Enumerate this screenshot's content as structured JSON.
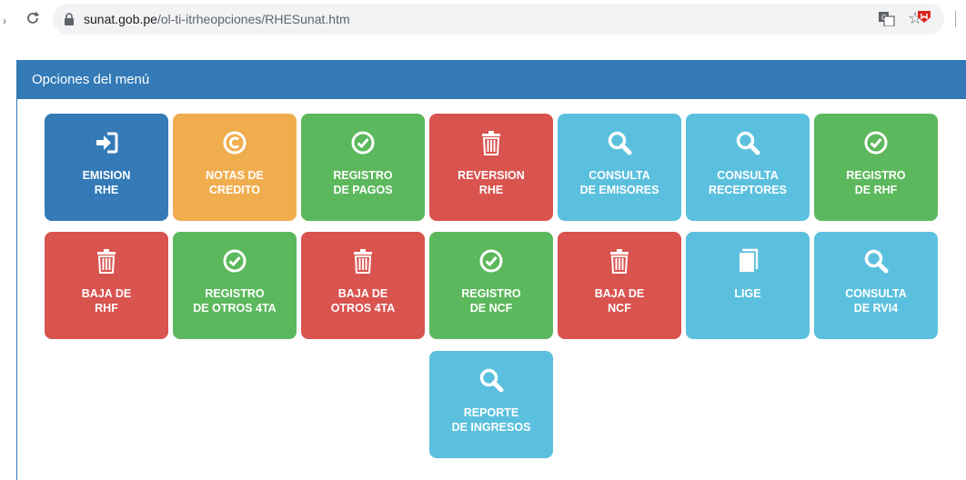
{
  "browser": {
    "url_host": "sunat.gob.pe",
    "url_path": "/ol-ti-itrheopciones/RHESunat.htm"
  },
  "panel": {
    "title": "Opciones del menú"
  },
  "tiles": [
    {
      "line1": "EMISION",
      "line2": "RHE",
      "icon": "sign-in-icon",
      "color": "#337ab7"
    },
    {
      "line1": "NOTAS DE",
      "line2": "CREDITO",
      "icon": "copyright-circle-icon",
      "color": "#f0ad4e"
    },
    {
      "line1": "REGISTRO",
      "line2": "DE PAGOS",
      "icon": "check-circle-icon",
      "color": "#5cb85c"
    },
    {
      "line1": "REVERSION",
      "line2": "RHE",
      "icon": "trash-icon",
      "color": "#d9534f"
    },
    {
      "line1": "CONSULTA",
      "line2": "DE EMISORES",
      "icon": "search-icon",
      "color": "#5bc0de"
    },
    {
      "line1": "CONSULTA",
      "line2": "RECEPTORES",
      "icon": "search-icon",
      "color": "#5bc0de"
    },
    {
      "line1": "REGISTRO",
      "line2": "DE RHF",
      "icon": "check-circle-icon",
      "color": "#5cb85c"
    },
    {
      "line1": "BAJA DE",
      "line2": "RHF",
      "icon": "trash-icon",
      "color": "#d9534f"
    },
    {
      "line1": "REGISTRO",
      "line2": "DE OTROS 4TA",
      "icon": "check-circle-icon",
      "color": "#5cb85c"
    },
    {
      "line1": "BAJA DE",
      "line2": "OTROS 4TA",
      "icon": "trash-icon",
      "color": "#d9534f"
    },
    {
      "line1": "REGISTRO",
      "line2": "DE NCF",
      "icon": "check-circle-icon",
      "color": "#5cb85c"
    },
    {
      "line1": "BAJA DE",
      "line2": "NCF",
      "icon": "trash-icon",
      "color": "#d9534f"
    },
    {
      "line1": "LIGE",
      "line2": "",
      "icon": "book-icon",
      "color": "#5bc0de"
    },
    {
      "line1": "CONSULTA",
      "line2": "DE RVI4",
      "icon": "search-icon",
      "color": "#5bc0de"
    },
    {
      "line1": "REPORTE",
      "line2": "DE INGRESOS",
      "icon": "search-icon",
      "color": "#5bc0de"
    }
  ]
}
